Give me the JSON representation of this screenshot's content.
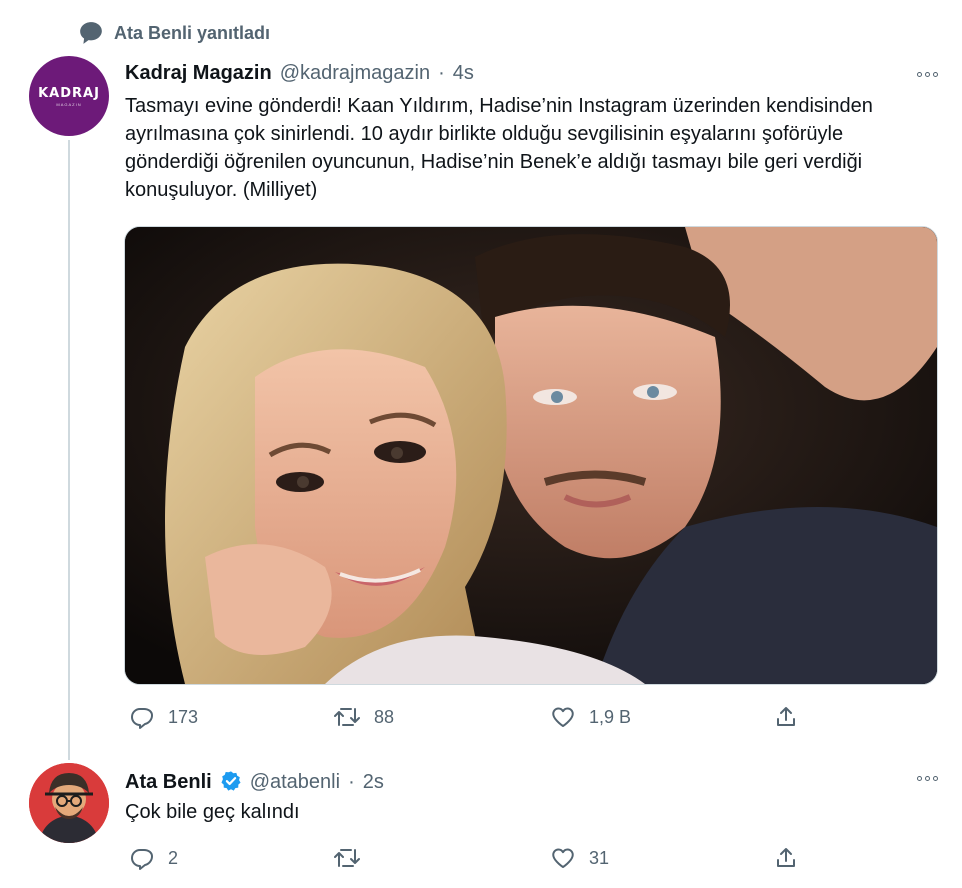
{
  "reply_context": {
    "label": "Ata Benli yanıtladı"
  },
  "tweets": [
    {
      "name": "Kadraj Magazin",
      "handle": "@kadrajmagazin",
      "separator": "·",
      "time": "4s",
      "avatar_text": "KADRAJ",
      "avatar_subtext": "MAGAZIN",
      "text": "Tasmayı evine gönderdi! Kaan Yıldırım, Hadise’nin Instagram üzerinden kendisinden ayrılmasına çok sinirlendi. 10 aydır birlikte olduğu sevgilisinin eşyalarını şoförüyle gönderdiği öğrenilen oyuncunun, Hadise’nin Benek’e aldığı tasmayı bile geri verdiği konuşuluyor. (Milliyet)",
      "replies": "173",
      "retweets": "88",
      "likes": "1,9 B"
    },
    {
      "name": "Ata Benli",
      "handle": "@atabenli",
      "separator": "·",
      "time": "2s",
      "verified": true,
      "text": "Çok bile geç kalındı",
      "replies": "2",
      "retweets": "",
      "likes": "31"
    }
  ],
  "icons": {
    "reply": "reply-icon",
    "retweet": "retweet-icon",
    "like": "heart-icon",
    "share": "share-icon",
    "more": "more-icon",
    "verified": "verified-badge-icon",
    "reply_context": "speech-bubble-icon"
  },
  "colors": {
    "text_primary": "#0f1419",
    "text_secondary": "#536471",
    "verified_blue": "#1d9bf0",
    "kadraj_purple": "#6d1a79"
  }
}
